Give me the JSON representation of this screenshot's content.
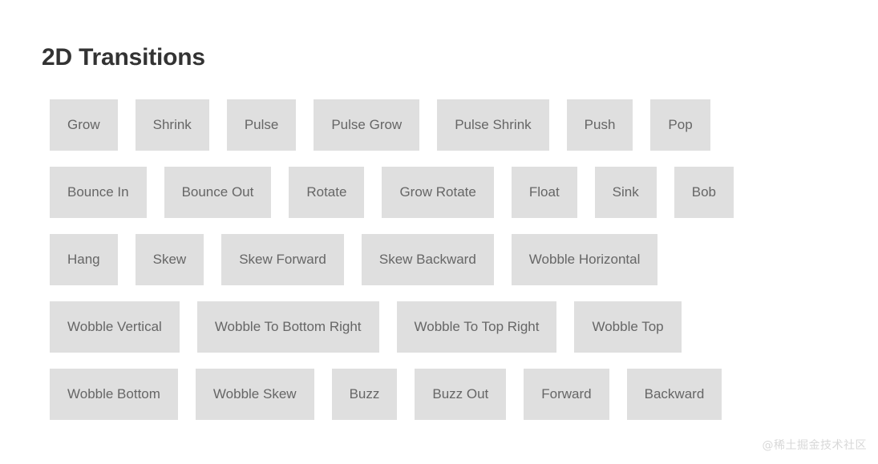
{
  "page": {
    "title": "2D Transitions",
    "background_color": "#ffffff",
    "title_color": "#333333",
    "button_color": "#dfdfdf",
    "button_text_color": "#666666"
  },
  "watermark": {
    "text": "@稀土掘金技术社区",
    "color": "#d8d8d8"
  },
  "rows": [
    {
      "buttons": [
        {
          "label": "Grow"
        },
        {
          "label": "Shrink"
        },
        {
          "label": "Pulse"
        },
        {
          "label": "Pulse Grow"
        },
        {
          "label": "Pulse Shrink"
        },
        {
          "label": "Push"
        },
        {
          "label": "Pop"
        }
      ]
    },
    {
      "buttons": [
        {
          "label": "Bounce In"
        },
        {
          "label": "Bounce Out"
        },
        {
          "label": "Rotate"
        },
        {
          "label": "Grow Rotate"
        },
        {
          "label": "Float"
        },
        {
          "label": "Sink"
        },
        {
          "label": "Bob"
        }
      ]
    },
    {
      "buttons": [
        {
          "label": "Hang"
        },
        {
          "label": "Skew"
        },
        {
          "label": "Skew Forward"
        },
        {
          "label": "Skew Backward"
        },
        {
          "label": "Wobble Horizontal"
        }
      ]
    },
    {
      "buttons": [
        {
          "label": "Wobble Vertical"
        },
        {
          "label": "Wobble To Bottom Right"
        },
        {
          "label": "Wobble To Top Right"
        },
        {
          "label": "Wobble Top"
        }
      ]
    },
    {
      "buttons": [
        {
          "label": "Wobble Bottom"
        },
        {
          "label": "Wobble Skew"
        },
        {
          "label": "Buzz"
        },
        {
          "label": "Buzz Out"
        },
        {
          "label": "Forward"
        },
        {
          "label": "Backward"
        }
      ]
    }
  ]
}
